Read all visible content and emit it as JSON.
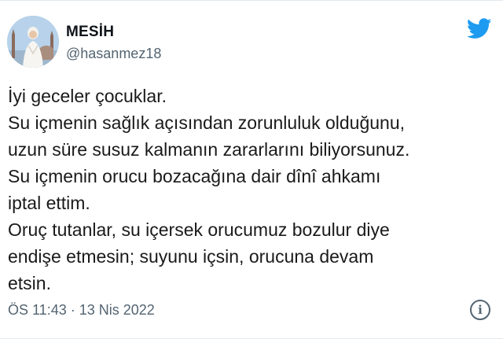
{
  "author": {
    "display_name": "MESİH",
    "handle": "@hasanmez18",
    "avatar_icon": "profile-avatar"
  },
  "brand": {
    "logo_icon": "twitter-bird-icon",
    "color": "#1d9bf0"
  },
  "tweet": {
    "lines": [
      "İyi geceler çocuklar.",
      "Su içmenin sağlık açısından zorunluluk olduğunu,",
      "uzun süre susuz kalmanın zararlarını biliyorsunuz.",
      "Su içmenin orucu bozacağına dair dînî ahkamı",
      "iptal ettim.",
      "Oruç tutanlar, su içersek orucumuz bozulur diye",
      "endişe etmesin; suyunu içsin, orucuna devam",
      "etsin."
    ]
  },
  "meta": {
    "timestamp": "ÖS 11:43 · 13 Nis 2022",
    "info_icon": "info-icon",
    "info_glyph": "i"
  }
}
